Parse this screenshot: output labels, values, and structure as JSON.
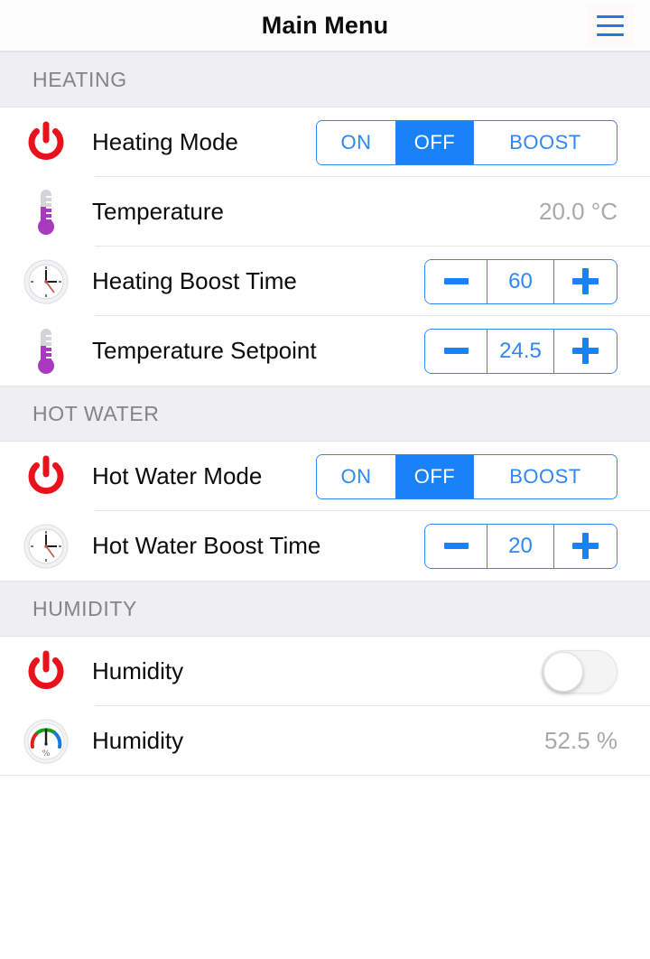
{
  "titlebar": {
    "title": "Main Menu",
    "menu_icon": "hamburger-menu-icon"
  },
  "colors": {
    "accent_blue": "#1a82f7",
    "segment_border": "#2f86f5",
    "power_red": "#e8121c",
    "thermometer_purple": "#a93ac0",
    "section_header_bg": "#eeeef3",
    "section_header_text": "#848487",
    "value_text": "#a9a9ad",
    "label_text": "#0b0b0b"
  },
  "sections": [
    {
      "header": "HEATING",
      "rows": [
        {
          "label": "Heating Mode",
          "icon": "power-icon",
          "control": "segmented",
          "segments": [
            "ON",
            "OFF",
            "BOOST"
          ],
          "selected": "OFF"
        },
        {
          "label": "Temperature",
          "icon": "thermometer-icon",
          "control": "value",
          "value": "20.0 °C"
        },
        {
          "label": "Heating Boost Time",
          "icon": "clock-icon",
          "control": "stepper",
          "value": "60",
          "minus_label": "−",
          "plus_label": "+"
        },
        {
          "label": "Temperature Setpoint",
          "icon": "thermometer-icon",
          "control": "stepper",
          "value": "24.5",
          "minus_label": "−",
          "plus_label": "+"
        }
      ]
    },
    {
      "header": "HOT WATER",
      "rows": [
        {
          "label": "Hot Water Mode",
          "icon": "power-icon",
          "control": "segmented",
          "segments": [
            "ON",
            "OFF",
            "BOOST"
          ],
          "selected": "OFF"
        },
        {
          "label": "Hot Water Boost Time",
          "icon": "clock-icon",
          "control": "stepper",
          "value": "20",
          "minus_label": "−",
          "plus_label": "+"
        }
      ]
    },
    {
      "header": "HUMIDITY",
      "rows": [
        {
          "label": "Humidity",
          "icon": "power-icon",
          "control": "toggle",
          "toggle_state": "off"
        },
        {
          "label": "Humidity",
          "icon": "humidity-gauge-icon",
          "control": "value",
          "value": "52.5 %"
        }
      ]
    }
  ]
}
